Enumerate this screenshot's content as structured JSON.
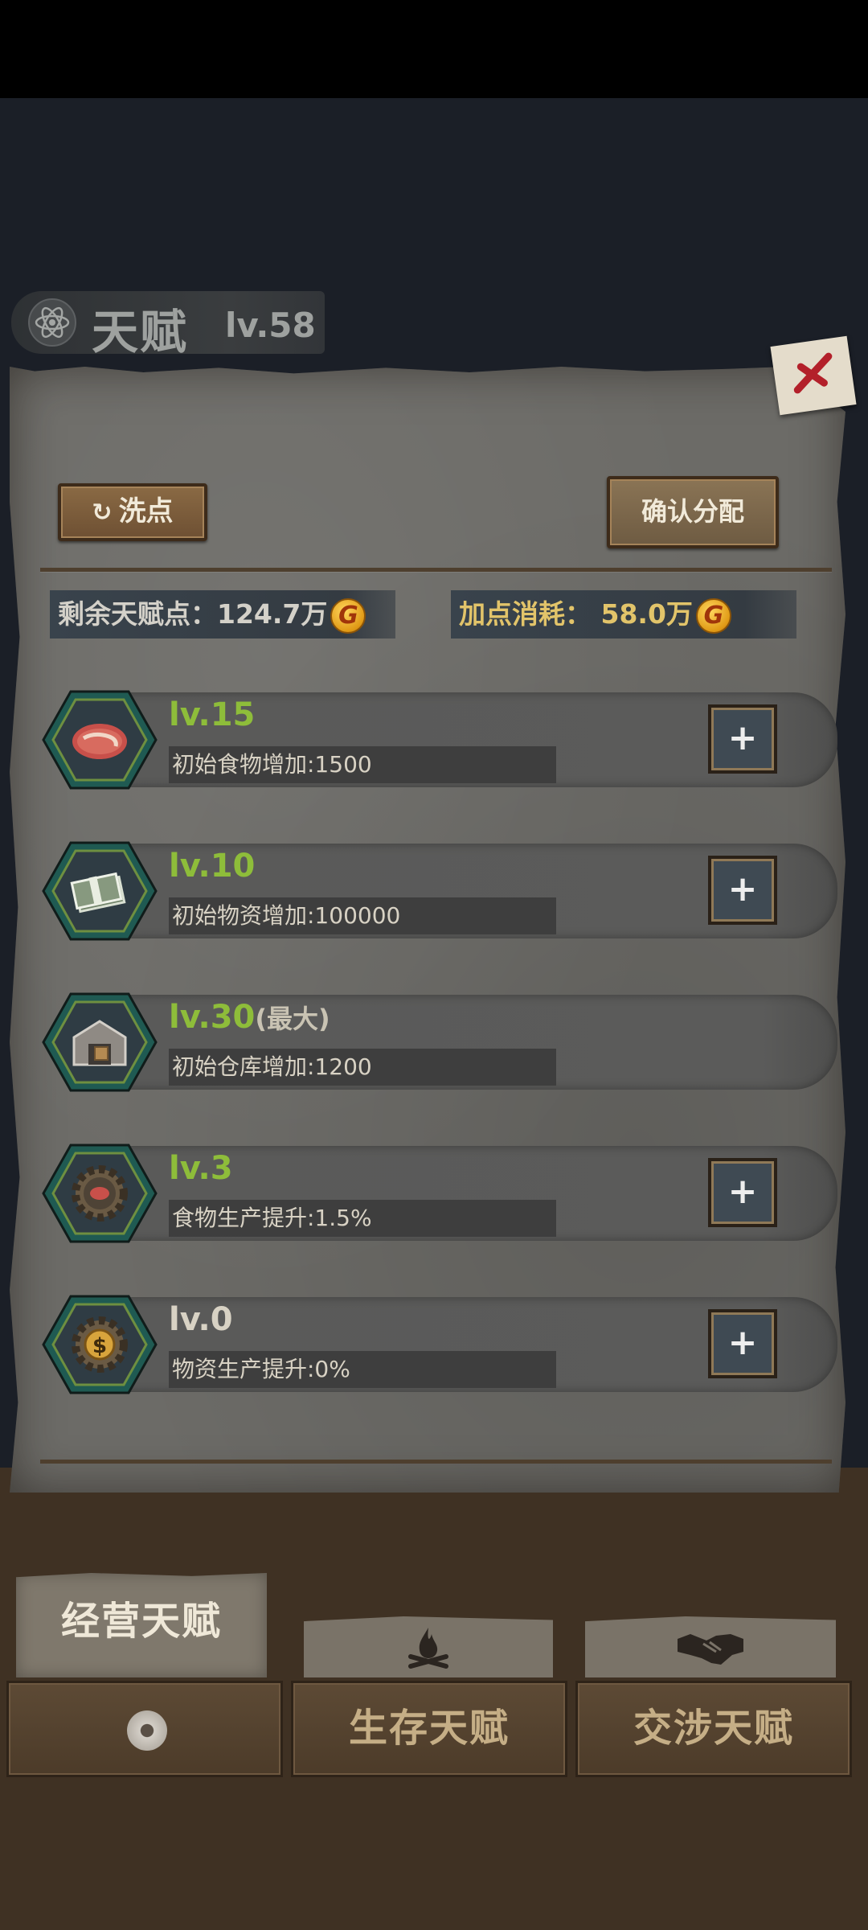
{
  "header": {
    "title": "天赋",
    "level": "lv.58",
    "icon": "atom-icon"
  },
  "actions": {
    "reset_label": "洗点",
    "confirm_label": "确认分配"
  },
  "stats": {
    "remaining_label": "剩余天赋点：124.7万",
    "cost_label": "加点消耗：  58.0万",
    "coin_glyph": "G"
  },
  "talents": [
    {
      "level": "lv.15",
      "max_tag": "",
      "description": "初始食物增加:1500",
      "icon": "meat-icon",
      "can_upgrade": true,
      "plus": "+"
    },
    {
      "level": "lv.10",
      "max_tag": "",
      "description": "初始物资增加:100000",
      "icon": "cash-stack-icon",
      "can_upgrade": true,
      "plus": "+"
    },
    {
      "level": "lv.30",
      "max_tag": "(最大)",
      "description": "初始仓库增加:1200",
      "icon": "warehouse-icon",
      "can_upgrade": false,
      "plus": ""
    },
    {
      "level": "lv.3",
      "max_tag": "",
      "description": "食物生产提升:1.5%",
      "icon": "gear-meat-icon",
      "can_upgrade": true,
      "plus": "+"
    },
    {
      "level": "lv.0",
      "max_tag": "",
      "description": "物资生产提升:0%",
      "icon": "gear-dollar-icon",
      "can_upgrade": true,
      "plus": "+"
    }
  ],
  "tabs": {
    "active_label": "经营天赋",
    "survival_icon": "campfire-icon",
    "trade_icon": "handshake-icon"
  },
  "bottom_tabs": {
    "survival_label": "生存天赋",
    "trade_label": "交涉天赋"
  },
  "colors": {
    "level_green": "#8ebd3a",
    "level_gray": "#d8d2c4",
    "cost_gold": "#e2c46a"
  }
}
